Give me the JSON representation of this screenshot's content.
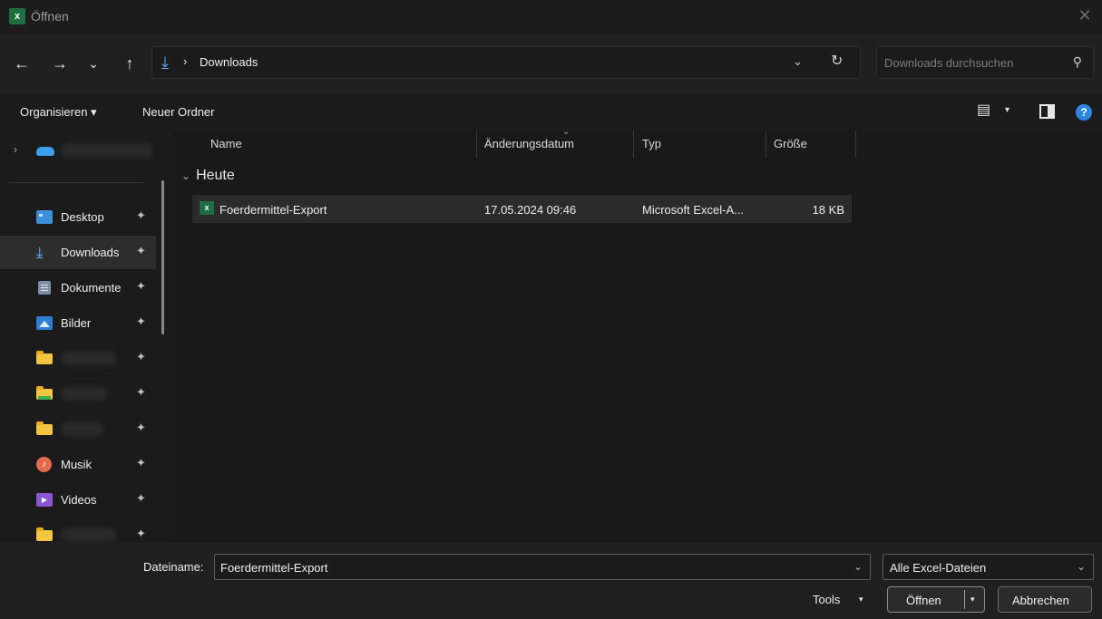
{
  "window": {
    "title": "Öffnen",
    "app_icon": "excel-icon",
    "close_glyph": "✕"
  },
  "nav": {
    "back": "←",
    "forward": "→",
    "recent": "⌄",
    "up": "↑"
  },
  "address": {
    "location": "Downloads",
    "separator": "›",
    "icon": "download-arrow-icon",
    "refresh": "↻",
    "dropdown": "⌄"
  },
  "search": {
    "placeholder": "Downloads durchsuchen",
    "icon": "⚲"
  },
  "command_bar": {
    "organize": "Organisieren ▾",
    "new_folder": "Neuer Ordner",
    "view_caret": "▾",
    "help": "?"
  },
  "sidebar": {
    "onedrive_chevron": "›",
    "items": [
      {
        "label": "Desktop",
        "icon": "desktop-icon",
        "pinned": true,
        "selected": false
      },
      {
        "label": "Downloads",
        "icon": "download-arrow-icon",
        "pinned": true,
        "selected": true
      },
      {
        "label": "Dokumente",
        "icon": "document-icon",
        "pinned": true,
        "selected": false
      },
      {
        "label": "Bilder",
        "icon": "pictures-icon",
        "pinned": true,
        "selected": false
      },
      {
        "label": "",
        "icon": "folder-icon",
        "pinned": true,
        "selected": false
      },
      {
        "label": "",
        "icon": "folder-icon",
        "pinned": true,
        "selected": false
      },
      {
        "label": "",
        "icon": "folder-icon",
        "pinned": true,
        "selected": false
      },
      {
        "label": "Musik",
        "icon": "music-icon",
        "pinned": true,
        "selected": false
      },
      {
        "label": "Videos",
        "icon": "video-icon",
        "pinned": true,
        "selected": false
      },
      {
        "label": "",
        "icon": "folder-icon",
        "pinned": true,
        "selected": false
      }
    ],
    "pin_glyph": "📌"
  },
  "columns": {
    "name": "Name",
    "modified": "Änderungsdatum",
    "type": "Typ",
    "size": "Größe"
  },
  "groups": [
    {
      "label": "Heute",
      "files": [
        {
          "name": "Foerdermittel-Export",
          "modified": "17.05.2024 09:46",
          "type": "Microsoft Excel-A...",
          "size": "18 KB",
          "selected": true
        }
      ]
    }
  ],
  "bottom": {
    "filename_label": "Dateiname:",
    "filename_value": "Foerdermittel-Export",
    "filter_value": "Alle Excel-Dateien",
    "tools": "Tools",
    "open": "Öffnen",
    "cancel": "Abbrechen"
  },
  "colors": {
    "background": "#1b1b1b",
    "selected": "#2d2d2d",
    "accent": "#5fb2ff",
    "excel_green": "#1d6f42"
  }
}
